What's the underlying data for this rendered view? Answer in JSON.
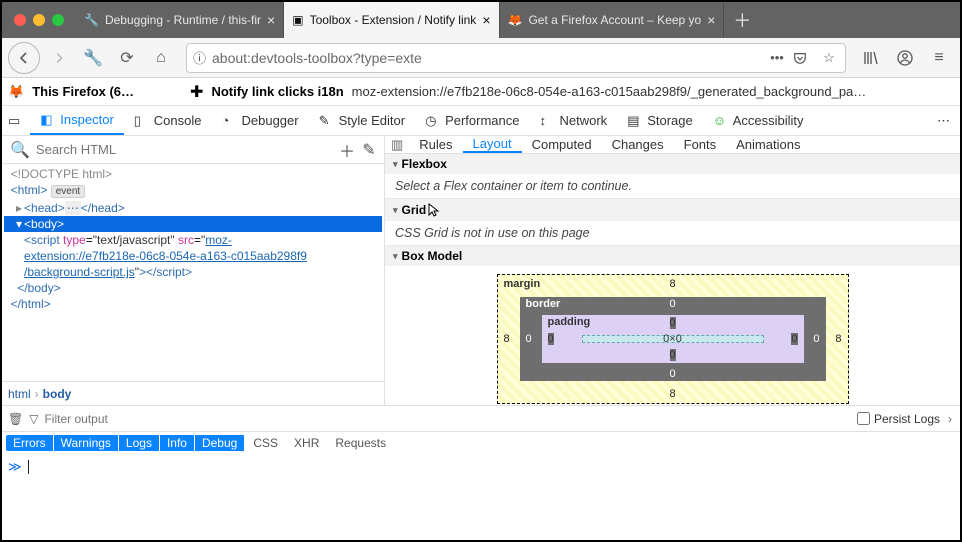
{
  "tabs": [
    {
      "label": "Debugging - Runtime / this-fir",
      "icon": "wrench"
    },
    {
      "label": "Toolbox - Extension / Notify link",
      "icon": "box",
      "active": true
    },
    {
      "label": "Get a Firefox Account – Keep yo",
      "icon": "firefox"
    }
  ],
  "url": "about:devtools-toolbox?type=exte",
  "context": {
    "left_label": "This Firefox (6…",
    "ext_title": "Notify link clicks i18n",
    "ext_path": "moz-extension://e7fb218e-06c8-054e-a163-c015aab298f9/_generated_background_pa…"
  },
  "tooltabs": [
    "Inspector",
    "Console",
    "Debugger",
    "Style Editor",
    "Performance",
    "Network",
    "Storage",
    "Accessibility"
  ],
  "search_placeholder": "Search HTML",
  "dom": {
    "doctype": "<!DOCTYPE html>",
    "html_open": "<html>",
    "event": "event",
    "head": "<head>…</head>",
    "body_open": "<body>",
    "script_open": "<script type=\"text/javascript\" src=\"",
    "script_url": "moz-extension://e7fb218e-06c8-054e-a163-c015aab298f9/background-script.js",
    "script_close": "\"></script>",
    "body_close": "</body>",
    "html_close": "</html>"
  },
  "crumbs": [
    "html",
    "body"
  ],
  "rule_tabs": [
    "Rules",
    "Layout",
    "Computed",
    "Changes",
    "Fonts",
    "Animations"
  ],
  "rule_selected": "Layout",
  "layout": {
    "flex_title": "Flexbox",
    "flex_body": "Select a Flex container or item to continue.",
    "grid_title": "Grid",
    "grid_body": "CSS Grid is not in use on this page",
    "box_title": "Box Model",
    "margin_label": "margin",
    "border_label": "border",
    "padding_label": "padding",
    "content": "0×0",
    "m_top": "8",
    "m_right": "8",
    "m_bottom": "8",
    "m_left": "8",
    "b_top": "0",
    "b_right": "0",
    "b_bottom": "0",
    "b_left": "0",
    "p_top": "0",
    "p_right": "0",
    "p_bottom": "0",
    "p_left": "0"
  },
  "console": {
    "filter_placeholder": "Filter output",
    "persist": "Persist Logs",
    "pills": [
      "Errors",
      "Warnings",
      "Logs",
      "Info",
      "Debug"
    ],
    "plain": [
      "CSS",
      "XHR",
      "Requests"
    ],
    "prompt": "≫"
  }
}
